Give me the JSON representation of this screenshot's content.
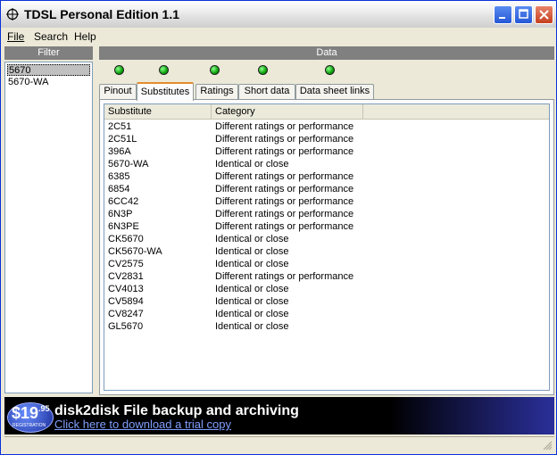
{
  "window": {
    "title": "TDSL Personal Edition 1.1"
  },
  "menu": {
    "file": "File",
    "search": "Search",
    "help": "Help"
  },
  "filter": {
    "header": "Filter",
    "items": [
      {
        "label": "5670",
        "selected": true
      },
      {
        "label": "5670-WA",
        "selected": false
      }
    ]
  },
  "data_panel": {
    "header": "Data",
    "leds": [
      "green",
      "green",
      "green",
      "green",
      "green"
    ],
    "tabs": [
      {
        "label": "Pinout",
        "active": false
      },
      {
        "label": "Substitutes",
        "active": true
      },
      {
        "label": "Ratings",
        "active": false
      },
      {
        "label": "Short data",
        "active": false
      },
      {
        "label": "Data sheet links",
        "active": false
      }
    ]
  },
  "substitutes": {
    "columns": [
      "Substitute",
      "Category"
    ],
    "rows": [
      [
        "2C51",
        "Different ratings or performance"
      ],
      [
        "2C51L",
        "Different ratings or performance"
      ],
      [
        "396A",
        "Different ratings or performance"
      ],
      [
        "5670-WA",
        "Identical or close"
      ],
      [
        "6385",
        "Different ratings or performance"
      ],
      [
        "6854",
        "Different ratings or performance"
      ],
      [
        "6CC42",
        "Different ratings or performance"
      ],
      [
        "6N3P",
        "Different ratings or performance"
      ],
      [
        "6N3PE",
        "Different ratings or performance"
      ],
      [
        "CK5670",
        "Identical or close"
      ],
      [
        "CK5670-WA",
        "Identical or close"
      ],
      [
        "CV2575",
        "Identical or close"
      ],
      [
        "CV2831",
        "Different ratings or performance"
      ],
      [
        "CV4013",
        "Identical or close"
      ],
      [
        "CV5894",
        "Identical or close"
      ],
      [
        "CV8247",
        "Identical or close"
      ],
      [
        "GL5670",
        "Identical or close"
      ]
    ]
  },
  "ad": {
    "price_main": "$19",
    "price_cents": ".95",
    "price_caption": "REGISTRATION",
    "title": "disk2disk File backup and archiving",
    "link": "Click here to download a trial copy"
  },
  "colors": {
    "led_green": "#0aa30a",
    "tab_accent": "#e68b2c",
    "header_gray": "#808080"
  }
}
